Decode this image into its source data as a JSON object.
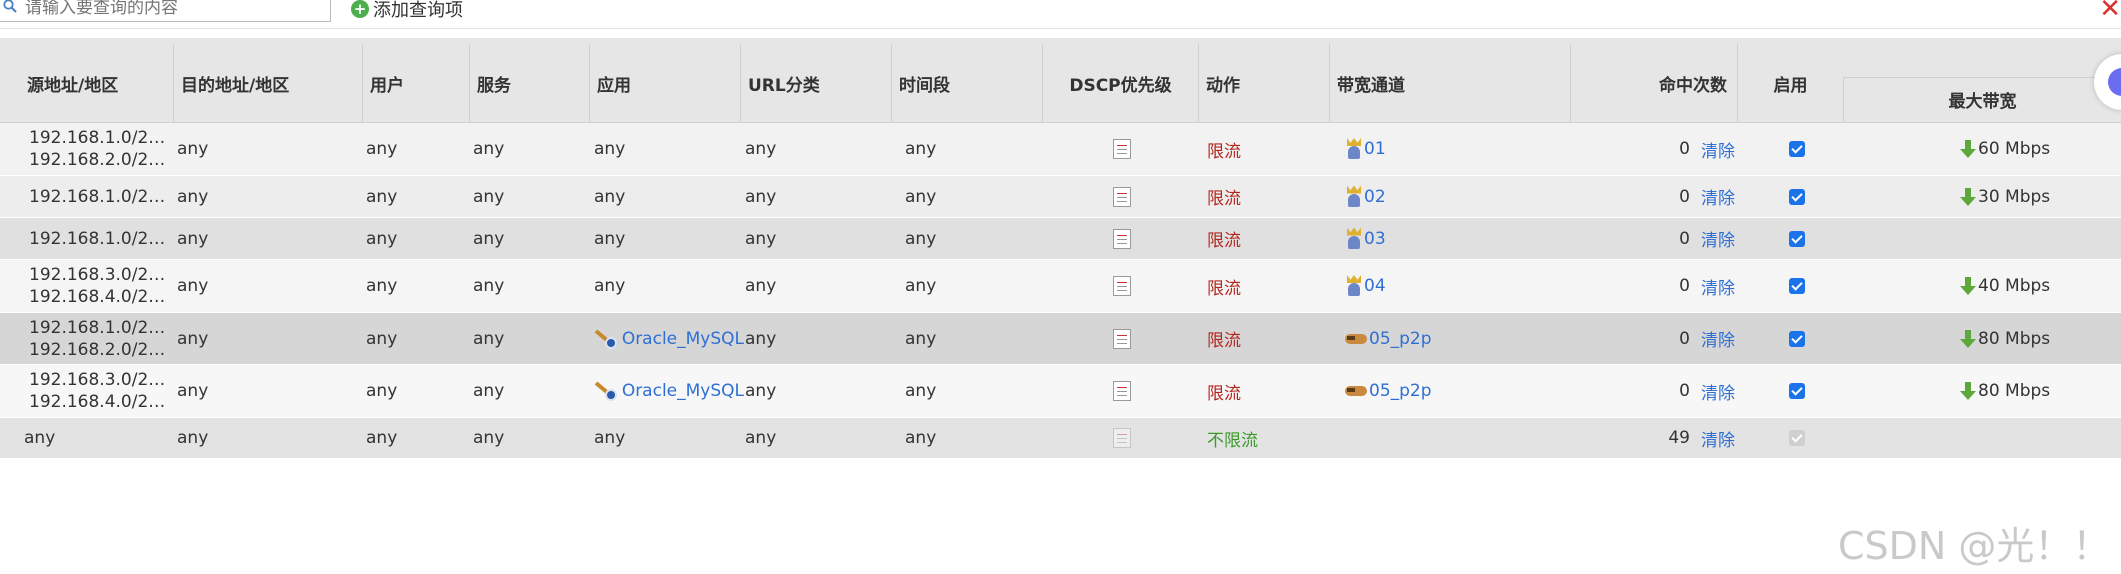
{
  "toolbar": {
    "search_placeholder": "请输入要查询的内容",
    "add_label": "添加查询项"
  },
  "table": {
    "headers": {
      "src": "源地址/地区",
      "dst": "目的地址/地区",
      "user": "用户",
      "service": "服务",
      "app": "应用",
      "url": "URL分类",
      "time": "时间段",
      "dscp": "DSCP优先级",
      "action": "动作",
      "channel": "带宽通道",
      "hits": "命中次数",
      "enable": "启用",
      "maxbw": "最大带宽"
    },
    "rows": [
      {
        "src1": "192.168.1.0/2…",
        "src2": "192.168.2.0/2…",
        "dst": "any",
        "user": "any",
        "service": "any",
        "app": "any",
        "app_link": false,
        "url": "any",
        "time": "any",
        "action": "限流",
        "action_type": "limit",
        "channel": "01",
        "channel_icon": "king",
        "hits": "0",
        "clear": "清除",
        "enabled": true,
        "bw": "60 Mbps",
        "bg": "#f2f2f2",
        "h": 52
      },
      {
        "src1": "192.168.1.0/2…",
        "src2": "",
        "dst": "any",
        "user": "any",
        "service": "any",
        "app": "any",
        "app_link": false,
        "url": "any",
        "time": "any",
        "action": "限流",
        "action_type": "limit",
        "channel": "02",
        "channel_icon": "king",
        "hits": "0",
        "clear": "清除",
        "enabled": true,
        "bw": "30 Mbps",
        "bg": "#ededed",
        "h": 41
      },
      {
        "src1": "192.168.1.0/2…",
        "src2": "",
        "dst": "any",
        "user": "any",
        "service": "any",
        "app": "any",
        "app_link": false,
        "url": "any",
        "time": "any",
        "action": "限流",
        "action_type": "limit",
        "channel": "03",
        "channel_icon": "king",
        "hits": "0",
        "clear": "清除",
        "enabled": true,
        "bw": "",
        "bg": "#e0e0e0",
        "h": 41
      },
      {
        "src1": "192.168.3.0/2…",
        "src2": "192.168.4.0/2…",
        "dst": "any",
        "user": "any",
        "service": "any",
        "app": "any",
        "app_link": false,
        "url": "any",
        "time": "any",
        "action": "限流",
        "action_type": "limit",
        "channel": "04",
        "channel_icon": "king",
        "hits": "0",
        "clear": "清除",
        "enabled": true,
        "bw": "40 Mbps",
        "bg": "#f5f5f5",
        "h": 52
      },
      {
        "src1": "192.168.1.0/2…",
        "src2": "192.168.2.0/2…",
        "dst": "any",
        "user": "any",
        "service": "any",
        "app": "Oracle_MySQL",
        "app_link": true,
        "url": "any",
        "time": "any",
        "action": "限流",
        "action_type": "limit",
        "channel": "05_p2p",
        "channel_icon": "hand",
        "hits": "0",
        "clear": "清除",
        "enabled": true,
        "bw": "80 Mbps",
        "bg": "#d6d6d6",
        "h": 51
      },
      {
        "src1": "192.168.3.0/2…",
        "src2": "192.168.4.0/2…",
        "dst": "any",
        "user": "any",
        "service": "any",
        "app": "Oracle_MySQL",
        "app_link": true,
        "url": "any",
        "time": "any",
        "action": "限流",
        "action_type": "limit",
        "channel": "05_p2p",
        "channel_icon": "hand",
        "hits": "0",
        "clear": "清除",
        "enabled": true,
        "bw": "80 Mbps",
        "bg": "#f7f7f7",
        "h": 52
      },
      {
        "src1": "any",
        "src2": "",
        "dst": "any",
        "user": "any",
        "service": "any",
        "app": "any",
        "app_link": false,
        "url": "any",
        "time": "any",
        "action": "不限流",
        "action_type": "nolimit",
        "channel": "",
        "channel_icon": "",
        "hits": "49",
        "clear": "清除",
        "enabled": false,
        "bw": "",
        "bg": "#e3e3e3",
        "h": 40
      }
    ]
  },
  "watermark": "CSDN @光！！",
  "colors": {
    "link": "#2f6fd3",
    "limit": "#b3261e",
    "nolimit": "#3a9a2a",
    "checkbox": "#1a73e8",
    "header_bg": "#e6e6e6"
  }
}
